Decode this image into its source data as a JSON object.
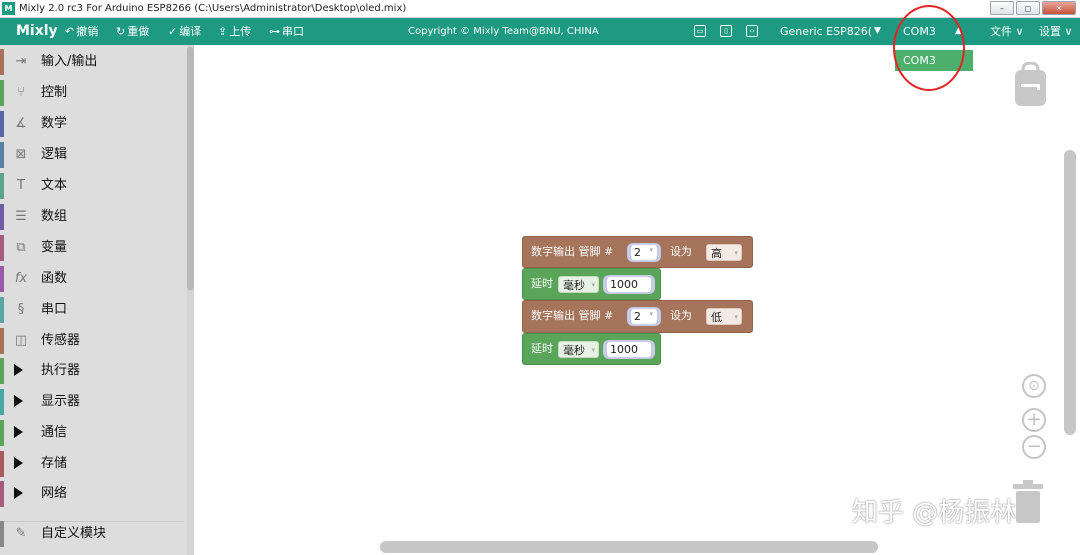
{
  "window": {
    "title": "Mixly 2.0 rc3 For Arduino ESP8266 (C:\\Users\\Administrator\\Desktop\\oled.mix)",
    "app_icon_text": "M"
  },
  "toolbar": {
    "brand": "Mixly",
    "undo": "撤销",
    "redo": "重做",
    "compile": "编译",
    "upload": "上传",
    "serial": "串口",
    "copyright": "Copyright © Mixly Team@BNU, CHINA",
    "board": "Generic ESP826(",
    "port": "COM3",
    "file_menu": "文件",
    "settings_menu": "设置"
  },
  "port_dropdown": {
    "options": [
      "COM3"
    ]
  },
  "sidebar": {
    "categories": [
      {
        "label": "输入/输出",
        "color": "#a5745b",
        "icon": "io-icon"
      },
      {
        "label": "控制",
        "color": "#5ba55b",
        "icon": "control-icon"
      },
      {
        "label": "数学",
        "color": "#5b67a5",
        "icon": "math-icon"
      },
      {
        "label": "逻辑",
        "color": "#5b80a5",
        "icon": "logic-icon"
      },
      {
        "label": "文本",
        "color": "#5ba58c",
        "icon": "text-icon"
      },
      {
        "label": "数组",
        "color": "#745ba5",
        "icon": "array-icon"
      },
      {
        "label": "变量",
        "color": "#a55b80",
        "icon": "variable-icon"
      },
      {
        "label": "函数",
        "color": "#995ba5",
        "icon": "function-icon"
      },
      {
        "label": "串口",
        "color": "#5ba5a5",
        "icon": "serial-icon"
      },
      {
        "label": "传感器",
        "color": "#a5745b",
        "icon": "sensor-icon"
      },
      {
        "label": "执行器",
        "color": "#5ba55b",
        "icon": "expand-icon"
      },
      {
        "label": "显示器",
        "color": "#4aa5a5",
        "icon": "expand-icon"
      },
      {
        "label": "通信",
        "color": "#5ba55b",
        "icon": "expand-icon"
      },
      {
        "label": "存储",
        "color": "#a55b5b",
        "icon": "expand-icon"
      },
      {
        "label": "网络",
        "color": "#a55b80",
        "icon": "expand-icon"
      },
      {
        "label": "自定义模块",
        "color": "#888888",
        "icon": "custom-module-icon"
      }
    ]
  },
  "blocks": [
    {
      "type": "digital_write",
      "label": "数字输出 管脚 #",
      "pin": "2",
      "set_label": "设为",
      "value": "高"
    },
    {
      "type": "delay",
      "label": "延时",
      "unit": "毫秒",
      "amount": "1000"
    },
    {
      "type": "digital_write",
      "label": "数字输出 管脚 #",
      "pin": "2",
      "set_label": "设为",
      "value": "低"
    },
    {
      "type": "delay",
      "label": "延时",
      "unit": "毫秒",
      "amount": "1000"
    }
  ],
  "watermark": "知乎 @杨振林"
}
